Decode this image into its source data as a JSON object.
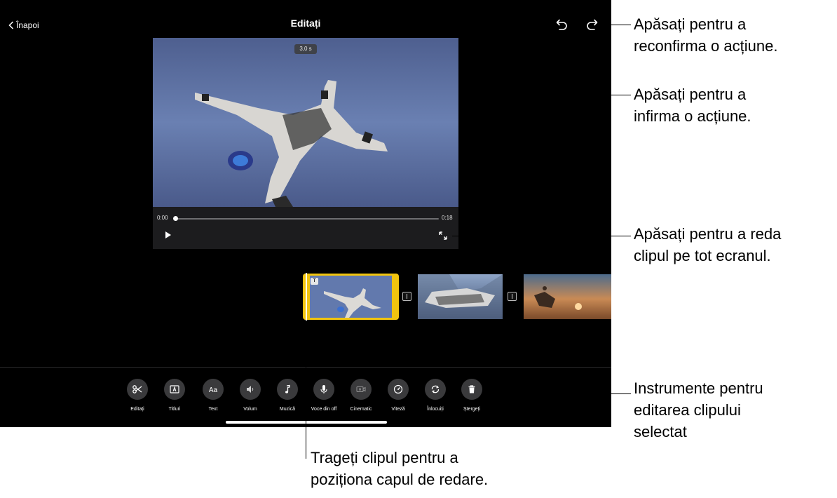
{
  "nav": {
    "back_label": "Înapoi",
    "title": "Editați"
  },
  "viewer": {
    "duration_badge": "3,0 s",
    "time_start": "0:00",
    "time_end": "0:18",
    "playback_progress": 0.0
  },
  "toolbar": {
    "tools": [
      {
        "label": "Editați",
        "icon": "scissors-icon"
      },
      {
        "label": "Titluri",
        "icon": "titles-icon"
      },
      {
        "label": "Text",
        "icon": "text-icon"
      },
      {
        "label": "Volum",
        "icon": "speaker-icon"
      },
      {
        "label": "Muzică",
        "icon": "music-note-icon"
      },
      {
        "label": "Voce din off",
        "icon": "microphone-icon"
      },
      {
        "label": "Cinematic",
        "icon": "cinematic-camera-icon"
      },
      {
        "label": "Viteză",
        "icon": "speed-gauge-icon"
      },
      {
        "label": "Înlocuiți",
        "icon": "replace-icon"
      },
      {
        "label": "Ștergeți",
        "icon": "trash-icon"
      }
    ]
  },
  "timeline": {
    "title_badge": "T"
  },
  "callouts": {
    "redo": [
      "Apăsați pentru a",
      "reconfirma o acțiune."
    ],
    "undo": [
      "Apăsați pentru a",
      "infirma o acțiune."
    ],
    "fullscreen": [
      "Apăsați pentru a reda",
      "clipul pe tot ecranul."
    ],
    "tools": [
      "Instrumente pentru",
      "editarea clipului",
      "selectat"
    ],
    "playhead": [
      "Trageți clipul pentru a",
      "poziționa capul de redare."
    ]
  },
  "colors": {
    "selection": "#f1c40f",
    "tool_circle": "#3a3a3c",
    "screen_bg": "#000000"
  }
}
